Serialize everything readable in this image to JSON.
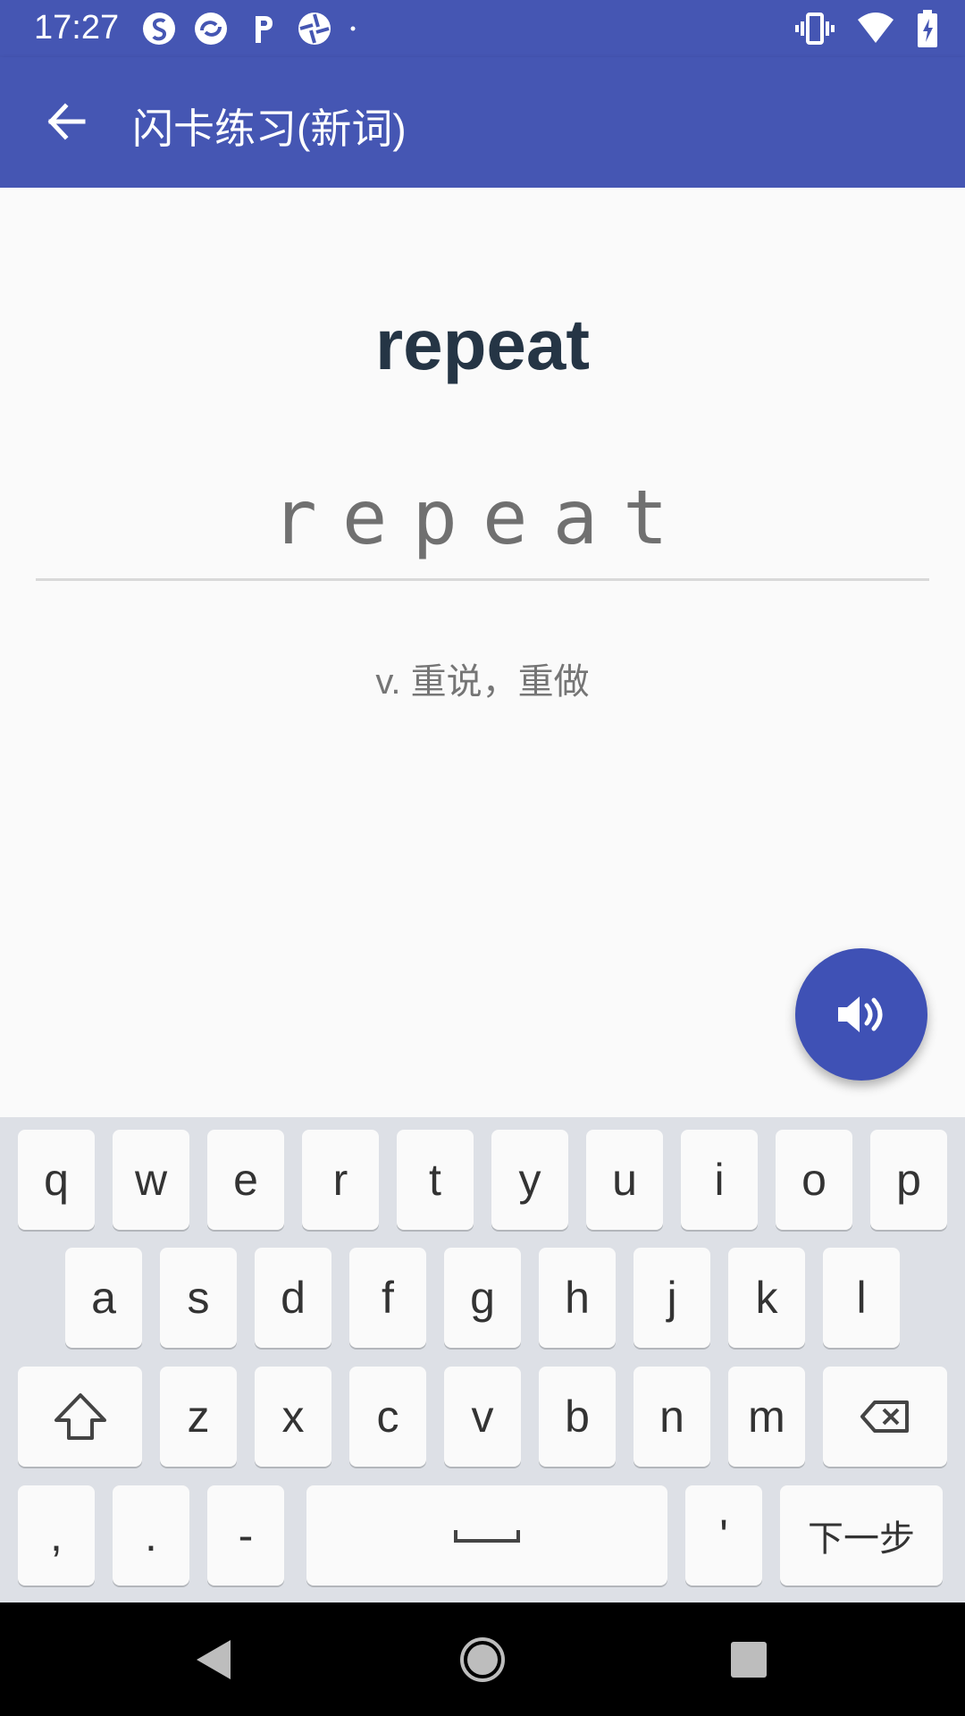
{
  "status_bar": {
    "time": "17:27",
    "left_icons": [
      "s-app-icon",
      "swirl-app-icon",
      "p-app-icon",
      "aperture-app-icon",
      "dot-icon"
    ],
    "right_icons": [
      "vibrate-icon",
      "wifi-icon",
      "battery-charging-icon"
    ]
  },
  "app_bar": {
    "title": "闪卡练习(新词)",
    "back_icon": "arrow-back-icon"
  },
  "card": {
    "word": "repeat",
    "input_value": "repeat",
    "meaning": "v. 重说，重做"
  },
  "fab": {
    "icon": "volume-up-icon"
  },
  "keyboard": {
    "row1": [
      "q",
      "w",
      "e",
      "r",
      "t",
      "y",
      "u",
      "i",
      "o",
      "p"
    ],
    "row2": [
      "a",
      "s",
      "d",
      "f",
      "g",
      "h",
      "j",
      "k",
      "l"
    ],
    "row3": [
      "z",
      "x",
      "c",
      "v",
      "b",
      "n",
      "m"
    ],
    "row4": {
      "comma": ",",
      "period": ".",
      "dash": "-",
      "apostrophe": "'",
      "enter": "下一步"
    }
  },
  "nav_bar": {
    "icons": [
      "back-triangle-icon",
      "home-circle-icon",
      "recents-square-icon"
    ]
  },
  "colors": {
    "primary": "#4556b3",
    "fab": "#3f51b5",
    "word": "#253545"
  }
}
